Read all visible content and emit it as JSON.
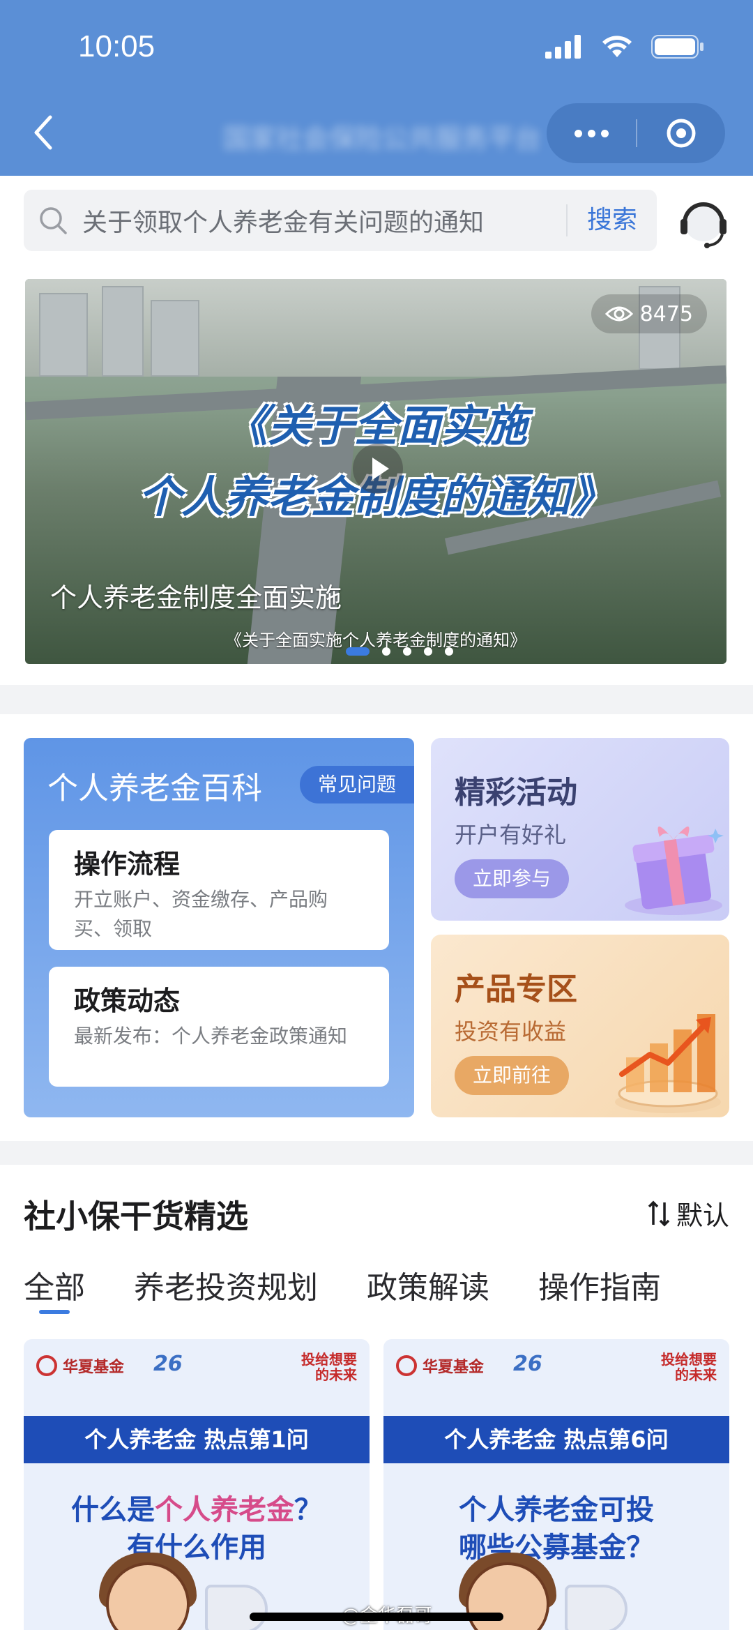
{
  "status_bar": {
    "time": "10:05"
  },
  "nav": {
    "title": "国家社会保险公共服务平台"
  },
  "search": {
    "placeholder": "关于领取个人养老金有关问题的通知",
    "button": "搜索"
  },
  "banner": {
    "views": "8475",
    "headline_line1": "《关于全面实施",
    "headline_line2": "个人养老金制度的通知》",
    "caption": "个人养老金制度全面实施",
    "subcaption": "《关于全面实施个人养老金制度的通知》",
    "slide_count": 5,
    "active_slide": 1
  },
  "wiki": {
    "title": "个人养老金百科",
    "faq_label": "常见问题",
    "items": [
      {
        "title": "操作流程",
        "desc": "开立账户、资金缴存、产品购买、领取"
      },
      {
        "title": "政策动态",
        "desc": "最新发布：个人养老金政策通知"
      }
    ]
  },
  "activities": [
    {
      "title": "精彩活动",
      "subtitle": "开户有好礼",
      "button": "立即参与"
    },
    {
      "title": "产品专区",
      "subtitle": "投资有收益",
      "button": "立即前往"
    }
  ],
  "articles_section": {
    "title": "社小保干货精选",
    "sort_label": "默认",
    "tabs": [
      "全部",
      "养老投资规划",
      "政策解读",
      "操作指南"
    ],
    "active_tab": 0,
    "cards": [
      {
        "brand": "华夏基金",
        "badge": "26",
        "slogan": "投给想要的未来",
        "bar": "个人养老金 热点第1问",
        "q_line1_pre": "什么是",
        "q_line1_hl": "个人养老金",
        "q_line1_post": "？",
        "q_line2": "有什么作用"
      },
      {
        "brand": "华夏基金",
        "badge": "26",
        "slogan": "投给想要的未来",
        "bar": "个人养老金 热点第6问",
        "q_line1_pre": "个人养老金可投",
        "q_line1_hl": "",
        "q_line1_post": "",
        "q_line2": "哪些公募基金？"
      }
    ]
  },
  "watermark": "@金华磊哥",
  "colors": {
    "header": "#5b8fd6",
    "accent": "#3b7be0",
    "brand_blue": "#1e4db7"
  }
}
